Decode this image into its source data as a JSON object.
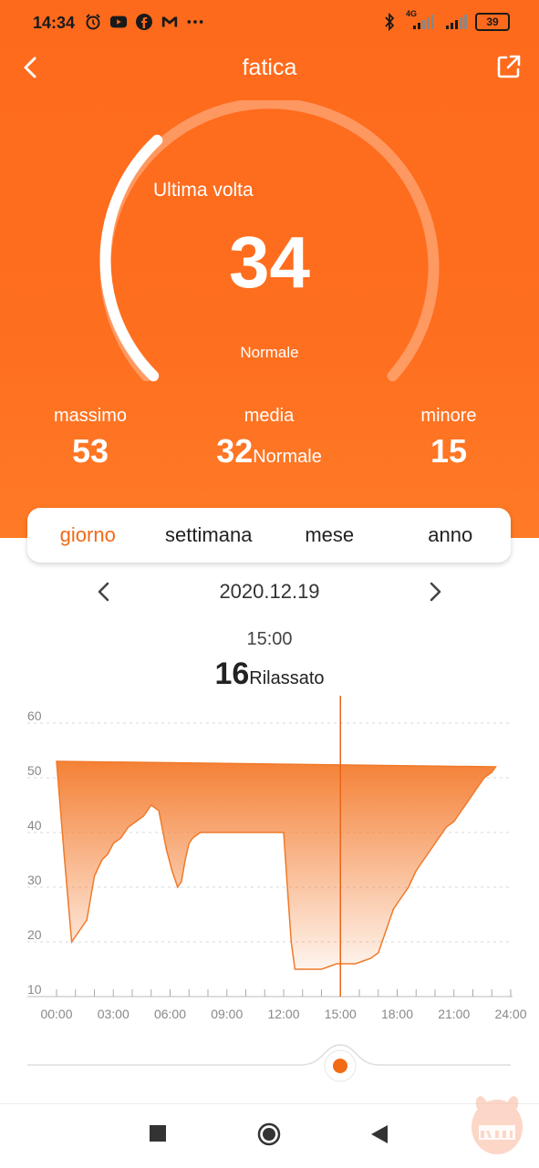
{
  "status_bar": {
    "time": "14:34",
    "battery": "39",
    "network": "4G"
  },
  "header": {
    "title": "fatica"
  },
  "gauge": {
    "label": "Ultima volta",
    "value": "34",
    "status": "Normale",
    "level": 0.34
  },
  "stats": {
    "max_label": "massimo",
    "max_value": "53",
    "avg_label": "media",
    "avg_value": "32",
    "avg_suffix": "Normale",
    "min_label": "minore",
    "min_value": "15"
  },
  "tabs": [
    "giorno",
    "settimana",
    "mese",
    "anno"
  ],
  "active_tab": "giorno",
  "date": "2020.12.19",
  "selected": {
    "time": "15:00",
    "value": "16",
    "status": "Rilassato"
  },
  "colors": {
    "accent": "#fe6a1c",
    "line": "#f07a2a"
  },
  "chart_data": {
    "type": "area",
    "y_ticks": [
      "60",
      "50",
      "40",
      "30",
      "20",
      "10"
    ],
    "x_ticks": [
      "00:00",
      "03:00",
      "06:00",
      "09:00",
      "12:00",
      "15:00",
      "18:00",
      "21:00",
      "24:00"
    ],
    "ylim": [
      10,
      60
    ],
    "xlim": [
      0,
      24
    ],
    "upper_x": [
      0,
      23.2
    ],
    "upper_y": [
      53,
      52
    ],
    "lower": {
      "x": [
        0,
        0.4,
        0.8,
        1.2,
        1.6,
        2.0,
        2.4,
        2.7,
        3.0,
        3.4,
        3.8,
        4.2,
        4.6,
        5.0,
        5.4,
        5.8,
        6.1,
        6.4,
        6.6,
        6.8,
        7.0,
        7.2,
        7.4,
        7.6,
        7.8,
        8.2,
        8.6,
        9.0,
        10.0,
        11.0,
        12.0,
        12.2,
        12.4,
        12.6,
        12.8,
        13.2,
        13.6,
        14.0,
        14.4,
        14.8,
        15.0,
        15.4,
        15.8,
        16.2,
        16.6,
        17.0,
        17.4,
        17.8,
        18.2,
        18.6,
        19.0,
        19.4,
        19.8,
        20.2,
        20.6,
        21.0,
        21.4,
        21.8,
        22.2,
        22.6,
        23.0,
        23.2
      ],
      "y": [
        53,
        36,
        20,
        22,
        24,
        32,
        35,
        36,
        38,
        39,
        41,
        42,
        43,
        45,
        44,
        37,
        33,
        30,
        31,
        35,
        38,
        39,
        39.5,
        40,
        40,
        40,
        40,
        40,
        40,
        40,
        40,
        30,
        20,
        15,
        15,
        15,
        15,
        15,
        15.5,
        16,
        16,
        16,
        16,
        16.5,
        17,
        18,
        22,
        26,
        28,
        30,
        33,
        35,
        37,
        39,
        41,
        42,
        44,
        46,
        48,
        50,
        51,
        52
      ]
    }
  }
}
